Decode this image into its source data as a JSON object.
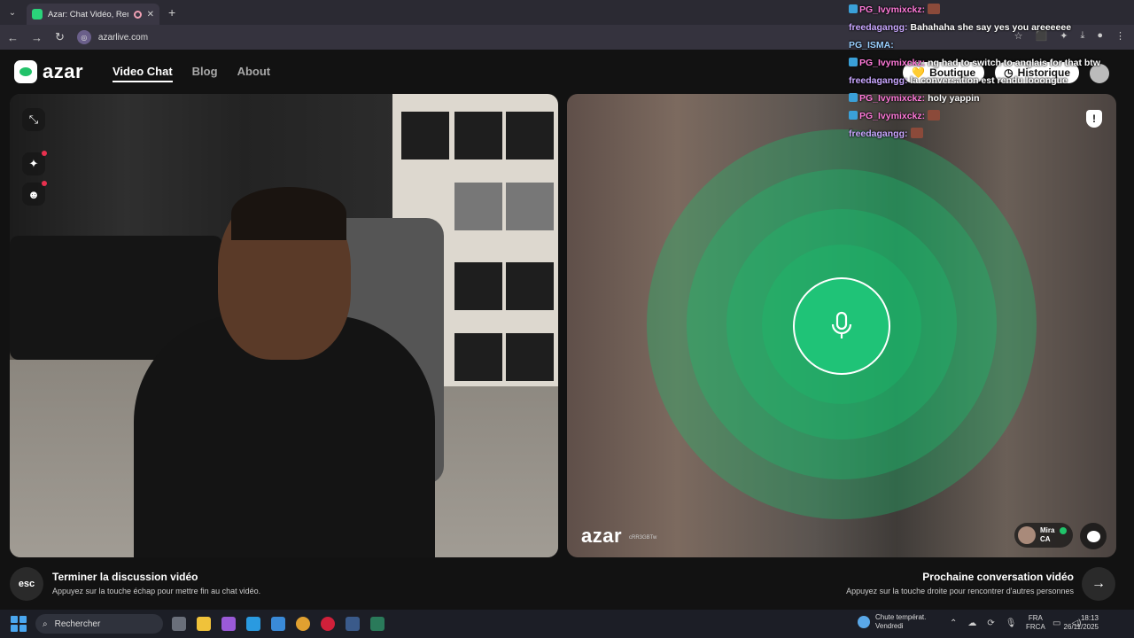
{
  "browser": {
    "tab_title": "Azar: Chat Vidéo, Rencontr",
    "url": "azarlive.com"
  },
  "header": {
    "logo_text": "azar",
    "nav": [
      {
        "label": "Video Chat",
        "active": true
      },
      {
        "label": "Blog",
        "active": false
      },
      {
        "label": "About",
        "active": false
      }
    ],
    "boutique_label": "Boutique",
    "historique_label": "Historique"
  },
  "video_right": {
    "logo_text": "azar",
    "watermark_id": "cRR3GBTw",
    "user_name": "Mira",
    "user_country": "CA"
  },
  "bottom": {
    "esc_label": "esc",
    "end_title": "Terminer la discussion vidéo",
    "end_subtitle": "Appuyez sur la touche échap pour mettre fin au chat vidéo.",
    "next_title": "Prochaine conversation vidéo",
    "next_subtitle": "Appuyez sur la touche droite pour rencontrer d'autres personnes"
  },
  "chat_overlay": [
    {
      "user": "PG_Ivymixckz:",
      "color": "#ff7ad9",
      "badges": true,
      "message": ""
    },
    {
      "user": "freedagangg:",
      "color": "#c9a7ff",
      "badges": false,
      "message": "Bahahaha she say yes you areeeeee"
    },
    {
      "user": "PG_ISMA:",
      "color": "#9ad0ff",
      "badges": false,
      "message": ""
    },
    {
      "user": "PG_Ivymixckz:",
      "color": "#ff7ad9",
      "badges": true,
      "message": "ng had to switch to anglais for that btw"
    },
    {
      "user": "freedagangg:",
      "color": "#c9a7ff",
      "badges": false,
      "message": "la conversation est rendu looongue"
    },
    {
      "user": "PG_Ivymixckz:",
      "color": "#ff7ad9",
      "badges": true,
      "message": "holy yappin"
    },
    {
      "user": "PG_Ivymixckz:",
      "color": "#ff7ad9",
      "badges": true,
      "message": ""
    },
    {
      "user": "freedagangg:",
      "color": "#c9a7ff",
      "badges": false,
      "message": ""
    }
  ],
  "taskbar": {
    "search_label": "Rechercher",
    "weather_title": "Chute températ.",
    "weather_day": "Vendredi",
    "lang_1": "FRA",
    "lang_2": "FRCA",
    "time": "18:13",
    "date": "26/11/2025"
  },
  "colors": {
    "accent_green": "#1fc377",
    "background": "#121212"
  }
}
